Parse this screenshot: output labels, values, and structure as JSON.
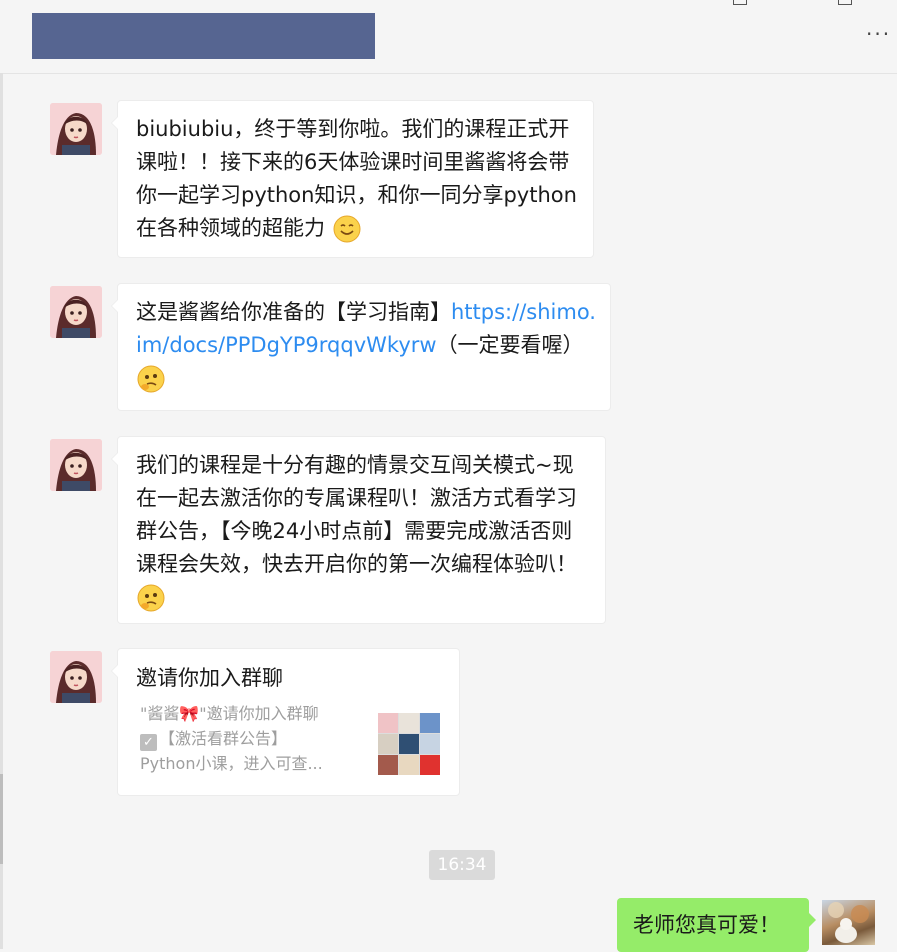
{
  "header": {
    "more_label": "···"
  },
  "messages": [
    {
      "segments": [
        {
          "type": "text",
          "text": "biubiubiu，终于等到你啦。我们的课程正式开课啦！！接下来的6天体验课时间里酱酱将会带你一起学习python知识，和你一同分享python在各种领域的超能力"
        },
        {
          "type": "emoji",
          "icon": "smile-emoji"
        }
      ]
    },
    {
      "segments": [
        {
          "type": "text",
          "text": "这是酱酱给你准备的【学习指南】"
        },
        {
          "type": "link",
          "text": "https://shimo.im/docs/PPDgYP9rqqvWkyrw"
        },
        {
          "type": "text",
          "text": "（一定要看喔）"
        },
        {
          "type": "emoji",
          "icon": "thinking-emoji"
        }
      ]
    },
    {
      "segments": [
        {
          "type": "text",
          "text": "我们的课程是十分有趣的情景交互闯关模式~现在一起去激活你的专属课程叭！激活方式看学习群公告，【今晚24小时点前】需要完成激活否则课程会失效，快去开启你的第一次编程体验叭！"
        },
        {
          "type": "emoji",
          "icon": "thinking-emoji"
        }
      ]
    }
  ],
  "invite_card": {
    "title": "邀请你加入群聊",
    "line1": "\"酱酱🎀\"邀请你加入群聊",
    "line2": "【激活看群公告】",
    "line3": "Python小课，进入可查..."
  },
  "timestamp": "16:34",
  "my_message": "老师您真可爱！",
  "colors": {
    "link": "#2d8cf0",
    "my_bubble": "#95ec69",
    "title_redaction": "#566591"
  }
}
